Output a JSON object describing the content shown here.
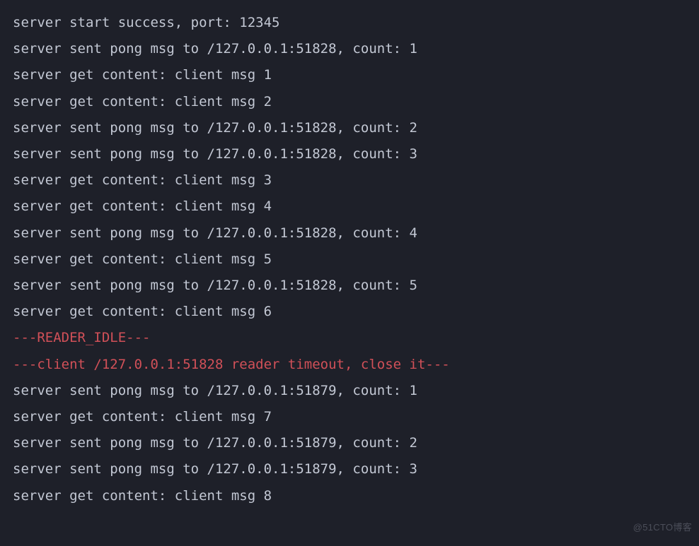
{
  "lines": [
    {
      "text": "server start success, port: 12345",
      "cls": ""
    },
    {
      "text": "server sent pong msg to /127.0.0.1:51828, count: 1",
      "cls": ""
    },
    {
      "text": "server get content: client msg 1",
      "cls": ""
    },
    {
      "text": "server get content: client msg 2",
      "cls": ""
    },
    {
      "text": "server sent pong msg to /127.0.0.1:51828, count: 2",
      "cls": ""
    },
    {
      "text": "server sent pong msg to /127.0.0.1:51828, count: 3",
      "cls": ""
    },
    {
      "text": "server get content: client msg 3",
      "cls": ""
    },
    {
      "text": "server get content: client msg 4",
      "cls": ""
    },
    {
      "text": "server sent pong msg to /127.0.0.1:51828, count: 4",
      "cls": ""
    },
    {
      "text": "server get content: client msg 5",
      "cls": ""
    },
    {
      "text": "server sent pong msg to /127.0.0.1:51828, count: 5",
      "cls": ""
    },
    {
      "text": "server get content: client msg 6",
      "cls": ""
    },
    {
      "text": "---READER_IDLE---",
      "cls": "err"
    },
    {
      "text": "---client /127.0.0.1:51828 reader timeout, close it---",
      "cls": "err"
    },
    {
      "text": "server sent pong msg to /127.0.0.1:51879, count: 1",
      "cls": ""
    },
    {
      "text": "server get content: client msg 7",
      "cls": ""
    },
    {
      "text": "server sent pong msg to /127.0.0.1:51879, count: 2",
      "cls": ""
    },
    {
      "text": "server sent pong msg to /127.0.0.1:51879, count: 3",
      "cls": ""
    },
    {
      "text": "server get content: client msg 8",
      "cls": ""
    }
  ],
  "watermark": "@51CTO博客",
  "colors": {
    "background": "#1e2029",
    "text": "#c3c8d4",
    "error": "#d15058",
    "watermark": "#6a6e7a"
  }
}
